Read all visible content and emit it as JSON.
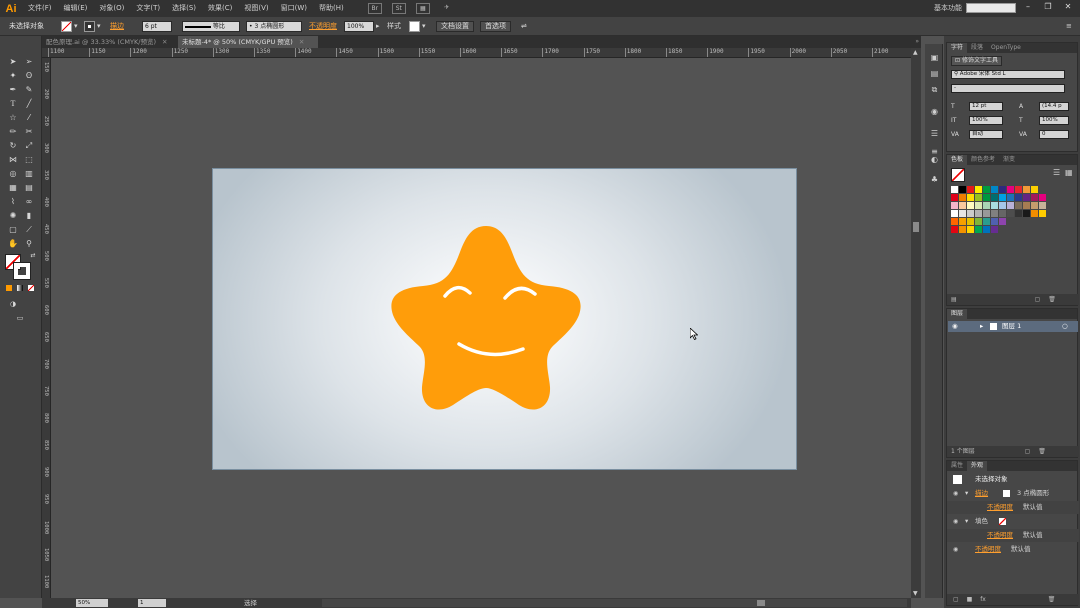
{
  "app": {
    "logo": "Ai"
  },
  "menus": [
    "文件(F)",
    "编辑(E)",
    "对象(O)",
    "文字(T)",
    "选择(S)",
    "效果(C)",
    "视图(V)",
    "窗口(W)",
    "帮助(H)"
  ],
  "menubar_extra": {
    "br_label": "Br",
    "st_label": "St",
    "workspace": "基本功能"
  },
  "control": {
    "selection_label": "未选择对象",
    "stroke_label": "描边",
    "stroke_weight": "6 pt",
    "stroke_profile": "等比",
    "brush": "3 点椭圆形",
    "opacity_label": "不透明度",
    "opacity_value": "100%",
    "style_label": "样式",
    "doc_setup": "文档设置",
    "preferences": "首选项"
  },
  "tabs": [
    {
      "label": "配色原理.ai @ 33.33% (CMYK/预览)",
      "active": false
    },
    {
      "label": "未标题-4* @ 50% (CMYK/GPU 预览)",
      "active": true
    }
  ],
  "ruler_h": [
    "1100",
    "1150",
    "1200",
    "1250",
    "1300",
    "1350",
    "1400",
    "1450",
    "1500",
    "1550",
    "1600",
    "1650",
    "1700",
    "1750",
    "1800",
    "1850",
    "1900",
    "1950",
    "2000",
    "2050",
    "2100",
    "2150"
  ],
  "ruler_v": [
    "150",
    "200",
    "250",
    "300",
    "350",
    "400",
    "450",
    "500",
    "550",
    "600",
    "650",
    "700",
    "750",
    "800",
    "850",
    "900",
    "950",
    "1000",
    "1050",
    "1100"
  ],
  "status": {
    "zoom": "50%",
    "page": "1",
    "tool": "选择"
  },
  "char_panel": {
    "tabs": [
      "字符",
      "段落",
      "OpenType"
    ],
    "touch_type": "修饰文字工具",
    "font": "Adobe 宋体 Std L",
    "style": "-",
    "size": "12 pt",
    "leading": "(14.4 p",
    "hscale": "100%",
    "vscale": "100%",
    "tracking": "自动",
    "kerning": "0"
  },
  "swatch_panel": {
    "tabs": [
      "色板",
      "颜色参考",
      "渐变"
    ]
  },
  "swatches": {
    "row1": [
      "#ffffff",
      "#000000",
      "#e51a1a",
      "#ffed00",
      "#009a3e",
      "#0087c7",
      "#2d2a7e",
      "#e6007e",
      "#e5282e",
      "#f19a38",
      "#fccf00"
    ],
    "row2": [
      "#e1001a",
      "#ef7d00",
      "#ffdd00",
      "#95c11f",
      "#00963f",
      "#006e6f",
      "#00a0e3",
      "#1d71b8",
      "#2b3a8c",
      "#662582",
      "#a3195b",
      "#e6007e"
    ],
    "row3": [
      "#f5b5c8",
      "#f9c99f",
      "#fffac0",
      "#dbe9b5",
      "#a9d5b5",
      "#a8dbe0",
      "#a5c6e8",
      "#b9b1d7",
      "#7b6c59",
      "#a67c52",
      "#c69c6d",
      "#c7b299"
    ],
    "row4": [
      "#ffffff",
      "#e6e6e6",
      "#cccccc",
      "#b3b3b3",
      "#999999",
      "#808080",
      "#666666",
      "#4d4d4d",
      "#333333",
      "#1a1a1a",
      "#f18d00",
      "#ffcc00"
    ],
    "row5": [
      "#ff6600",
      "#f5a000",
      "#e2c000",
      "#7fb539",
      "#2a9d8f",
      "#5060b0",
      "#8e44ad"
    ],
    "row6": [
      "#e30613",
      "#f39200",
      "#ffd500",
      "#00a651",
      "#0072bc",
      "#662d91"
    ]
  },
  "layers_panel": {
    "tab": "图层",
    "layer_name": "图层 1",
    "count": "1 个图层"
  },
  "appearance_panel": {
    "tabs": [
      "属性",
      "外观"
    ],
    "title": "未选择对象",
    "stroke_label": "描边",
    "stroke_value": "3 点椭圆形",
    "opacity_label": "不透明度",
    "opacity_value": "默认值",
    "fill_label": "填色"
  },
  "star": {
    "fill": "#ff9d0a",
    "stroke": "#ffffff"
  }
}
